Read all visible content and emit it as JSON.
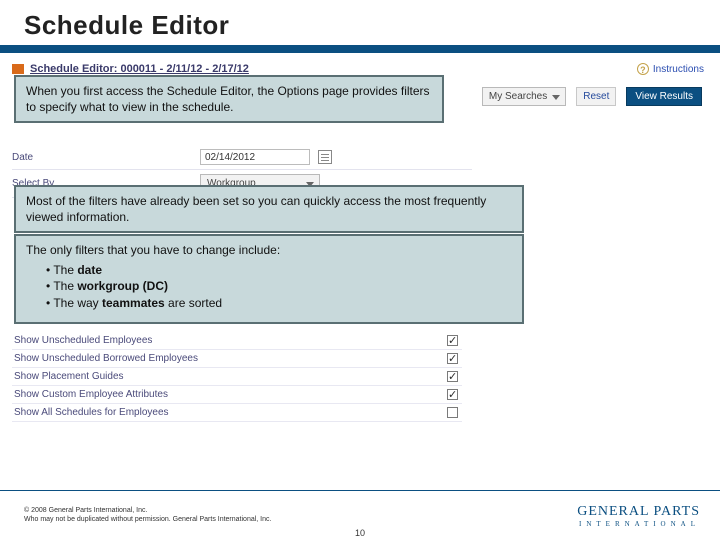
{
  "title": "Schedule Editor",
  "breadcrumb": "Schedule Editor: 000011 - 2/11/12 - 2/17/12",
  "instructions_label": "Instructions",
  "controls": {
    "my_searches": "My Searches",
    "reset": "Reset",
    "view_results": "View Results"
  },
  "form": {
    "date_label": "Date",
    "date_value": "02/14/2012",
    "select_by_label": "Select By",
    "select_by_value": "Workgroup"
  },
  "callouts": {
    "c1": "When you first access the Schedule Editor, the Options page provides filters to specify what to view in the schedule.",
    "c2": "Most of the filters have already been set so you can quickly access the most frequently viewed information.",
    "c3_lead": "The only filters that you have to change include:",
    "c3_bullets": [
      {
        "pre": "The ",
        "bold": "date",
        "post": ""
      },
      {
        "pre": "The ",
        "bold": "workgroup (DC)",
        "post": ""
      },
      {
        "pre": "The way ",
        "bold": "teammates",
        "post": " are sorted"
      }
    ]
  },
  "checks": [
    {
      "label": "Show Unscheduled Employees",
      "checked": true
    },
    {
      "label": "Show Unscheduled Borrowed Employees",
      "checked": true
    },
    {
      "label": "Show Placement Guides",
      "checked": true
    },
    {
      "label": "Show Custom Employee Attributes",
      "checked": true
    },
    {
      "label": "Show All Schedules for Employees",
      "checked": false
    }
  ],
  "footer": {
    "copy1": "© 2008 General Parts International, Inc.",
    "copy2": "Who may not be duplicated without permission. General Parts International, Inc.",
    "page": "10",
    "logo1": "GENERAL PARTS",
    "logo2": "INTERNATIONAL"
  }
}
